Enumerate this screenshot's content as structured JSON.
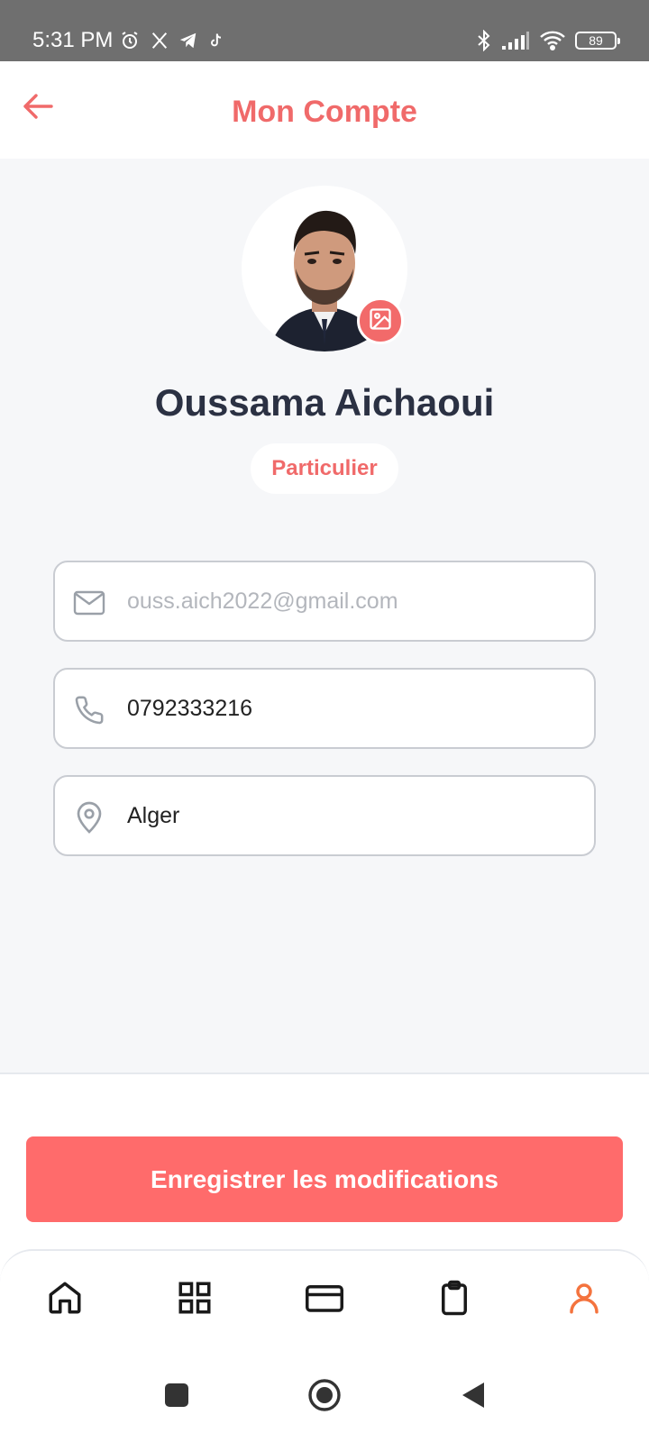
{
  "status_bar": {
    "time": "5:31 PM",
    "left_icons": [
      "alarm-icon",
      "x-icon",
      "telegram-icon",
      "tiktok-icon"
    ],
    "right_icons": [
      "bluetooth-icon",
      "signal-icon",
      "wifi-icon"
    ],
    "battery_level": "89"
  },
  "header": {
    "back_icon": "arrow-left-icon",
    "title": "Mon Compte"
  },
  "profile": {
    "avatar_edit_icon": "image-icon",
    "name": "Oussama Aichaoui",
    "account_type": "Particulier"
  },
  "form": {
    "email": {
      "icon": "mail-icon",
      "value": "",
      "placeholder": "ouss.aich2022@gmail.com"
    },
    "phone": {
      "icon": "phone-icon",
      "value": "0792333216"
    },
    "city": {
      "icon": "location-pin-icon",
      "value": "Alger"
    }
  },
  "actions": {
    "save_label": "Enregistrer les modifications"
  },
  "bottom_nav": {
    "items": [
      {
        "icon": "home-icon",
        "active": false
      },
      {
        "icon": "grid-icon",
        "active": false
      },
      {
        "icon": "credit-card-icon",
        "active": false
      },
      {
        "icon": "clipboard-icon",
        "active": false
      },
      {
        "icon": "user-icon",
        "active": true
      }
    ]
  },
  "colors": {
    "accent": "#f06a6a",
    "button": "#ff6b6b",
    "active_nav": "#f4733e",
    "text_dark": "#2b3143"
  }
}
